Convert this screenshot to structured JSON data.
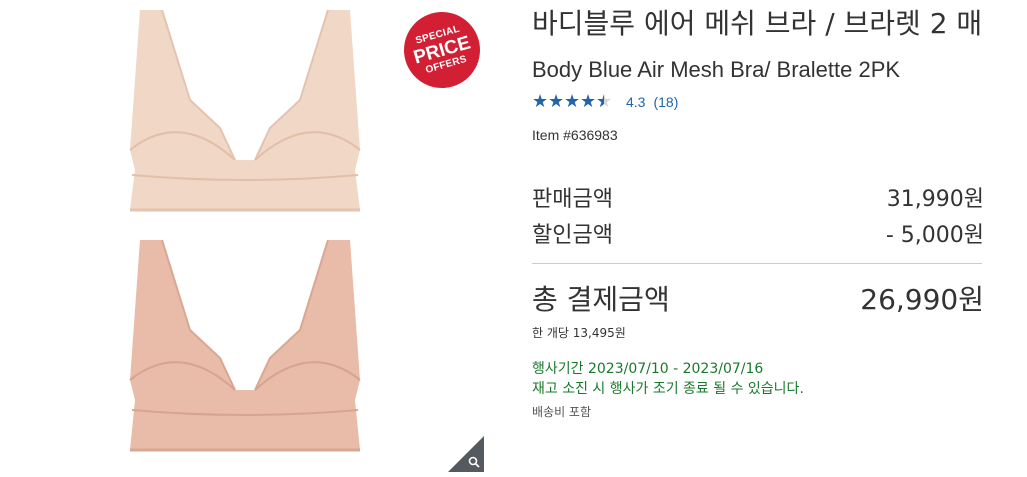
{
  "badge": {
    "line1": "SPECIAL",
    "line2": "PRICE",
    "line3": "OFFERS"
  },
  "product": {
    "title_ko": "바디블루 에어 메쉬 브라 / 브라렛 2 매",
    "title_en": "Body Blue Air Mesh Bra/ Bralette 2PK",
    "rating_value": "4.3",
    "rating_count": "(18)",
    "rating_score": 4.3,
    "item_number": "Item #636983"
  },
  "pricing": {
    "sale_label": "판매금액",
    "sale_value": "31,990원",
    "discount_label": "할인금액",
    "discount_value": "- 5,000원",
    "total_label": "총 결제금액",
    "total_value": "26,990원",
    "per_unit": "한 개당 13,495원",
    "event_period": "행사기간 2023/07/10 - 2023/07/16",
    "event_note": "재고 소진 시 행사가 조기 종료 될 수 있습니다.",
    "shipping": "배송비 포함"
  },
  "colors": {
    "badge_red": "#d21f33",
    "star_blue": "#2265a8",
    "event_green": "#1a7a2c",
    "bra_top": "#f1d7c6",
    "bra_bottom": "#e8bca8"
  },
  "icons": {
    "zoom": "magnifier-icon",
    "badge": "special-price-badge"
  }
}
